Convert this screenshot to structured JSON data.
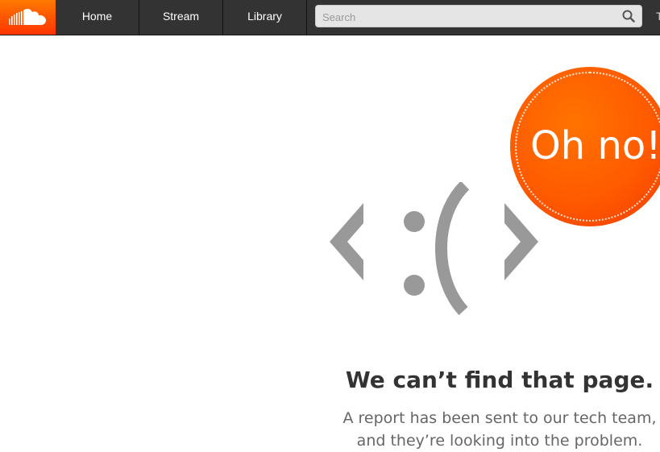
{
  "header": {
    "logo_icon": "soundcloud-cloud-icon",
    "nav": {
      "home": "Home",
      "stream": "Stream",
      "library": "Library"
    },
    "search": {
      "placeholder": "Search",
      "icon": "search-icon"
    }
  },
  "error": {
    "badge": "Oh no!",
    "face_icon": "sad-face-code-icon",
    "title": "We can’t find that page.",
    "message_line1": "A report has been sent to our tech team,",
    "message_line2": "and they’re looking into the problem."
  },
  "colors": {
    "brand": "#ff5500",
    "topbar": "#333333",
    "face": "#999999"
  }
}
